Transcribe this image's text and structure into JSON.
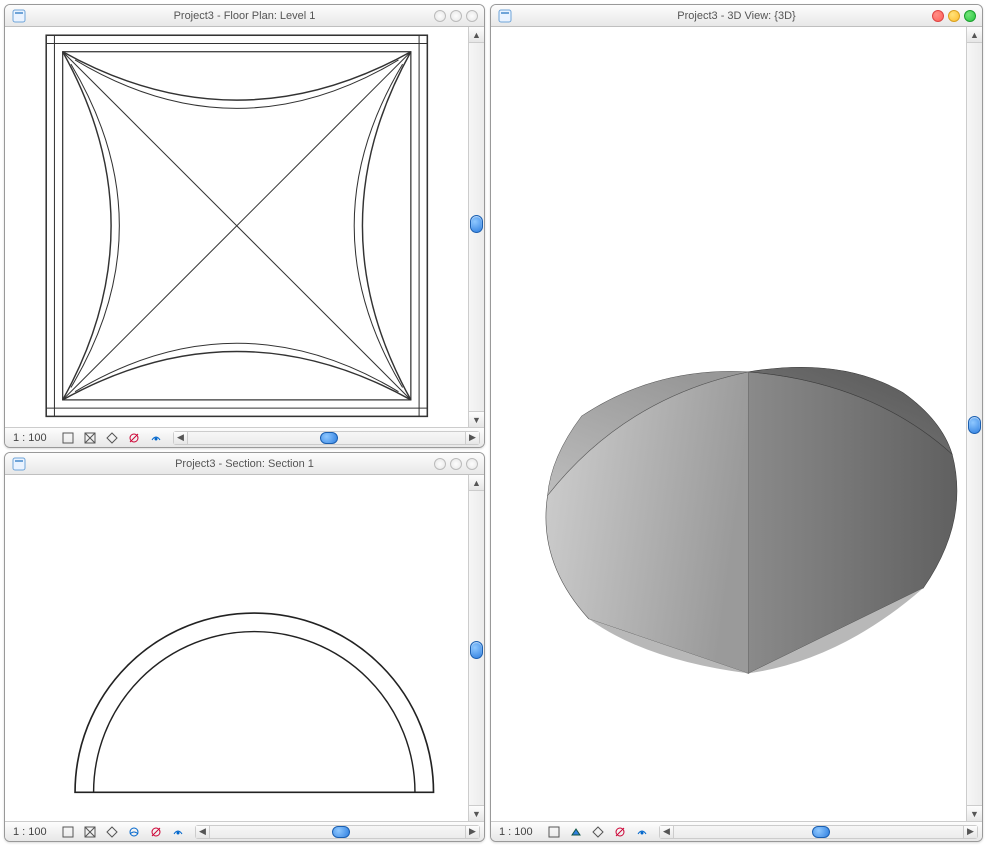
{
  "panes": {
    "floorplan": {
      "title": "Project3 - Floor Plan: Level 1",
      "scale": "1 : 100",
      "active": false
    },
    "section": {
      "title": "Project3 - Section: Section 1",
      "scale": "1 : 100",
      "active": false
    },
    "view3d": {
      "title": "Project3 - 3D View: {3D}",
      "scale": "1 : 100",
      "active": true
    }
  },
  "icons": {
    "app": "document-icon",
    "status": [
      "model-graphics-icon",
      "shadows-icon",
      "crop-icon",
      "reveal-icon",
      "hide-icon"
    ]
  },
  "colors": {
    "scroll_thumb": "#2f7fe0",
    "dome_light": "#d2d2d2",
    "dome_mid": "#a9a9a9",
    "dome_dark": "#707070"
  }
}
